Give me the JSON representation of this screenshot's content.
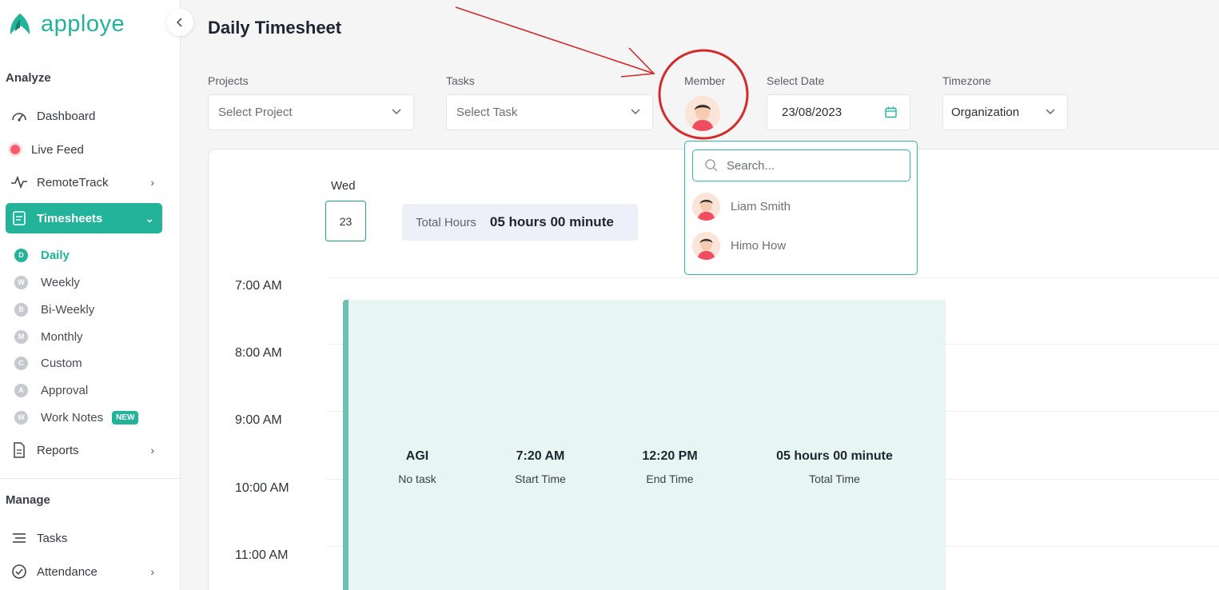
{
  "brand": {
    "name": "apploye",
    "accent": "#22b39a"
  },
  "sidebar": {
    "collapse_icon": "chevron-left-icon",
    "analyze_label": "Analyze",
    "items": [
      {
        "label": "Dashboard",
        "icon": "speedometer-icon"
      },
      {
        "label": "Live Feed",
        "icon": "live-dot-icon"
      },
      {
        "label": "RemoteTrack",
        "icon": "pulse-icon"
      },
      {
        "label": "Timesheets",
        "icon": "timesheet-icon"
      }
    ],
    "timesheet_subitems": [
      {
        "badge": "D",
        "label": "Daily"
      },
      {
        "badge": "W",
        "label": "Weekly"
      },
      {
        "badge": "B",
        "label": "Bi-Weekly"
      },
      {
        "badge": "M",
        "label": "Monthly"
      },
      {
        "badge": "C",
        "label": "Custom"
      },
      {
        "badge": "A",
        "label": "Approval"
      },
      {
        "badge": "W",
        "label": "Work Notes",
        "tag": "NEW"
      }
    ],
    "reports_label": "Reports",
    "manage_label": "Manage",
    "manage_items": [
      {
        "label": "Tasks",
        "icon": "list-icon"
      },
      {
        "label": "Attendance",
        "icon": "clock-check-icon"
      }
    ]
  },
  "header": {
    "title": "Daily Timesheet"
  },
  "filters": {
    "projects": {
      "label": "Projects",
      "value": "Select Project"
    },
    "tasks": {
      "label": "Tasks",
      "value": "Select Task"
    },
    "member": {
      "label": "Member"
    },
    "date": {
      "label": "Select Date",
      "value": "23/08/2023"
    },
    "timezone": {
      "label": "Timezone",
      "value": "Organization"
    }
  },
  "member_dropdown": {
    "search_placeholder": "Search...",
    "members": [
      {
        "name": "Liam Smith"
      },
      {
        "name": "Himo How"
      }
    ]
  },
  "timesheet": {
    "day_name": "Wed",
    "day_number": "23",
    "total_label": "Total Hours",
    "total_value": "05 hours 00 minute",
    "hours": [
      "7:00 AM",
      "8:00 AM",
      "9:00 AM",
      "10:00 AM",
      "11:00 AM"
    ],
    "entry": {
      "project": "AGI",
      "task": "No task",
      "start": "7:20 AM",
      "start_label": "Start Time",
      "end": "12:20 PM",
      "end_label": "End Time",
      "total": "05 hours 00 minute",
      "total_label": "Total Time"
    }
  }
}
